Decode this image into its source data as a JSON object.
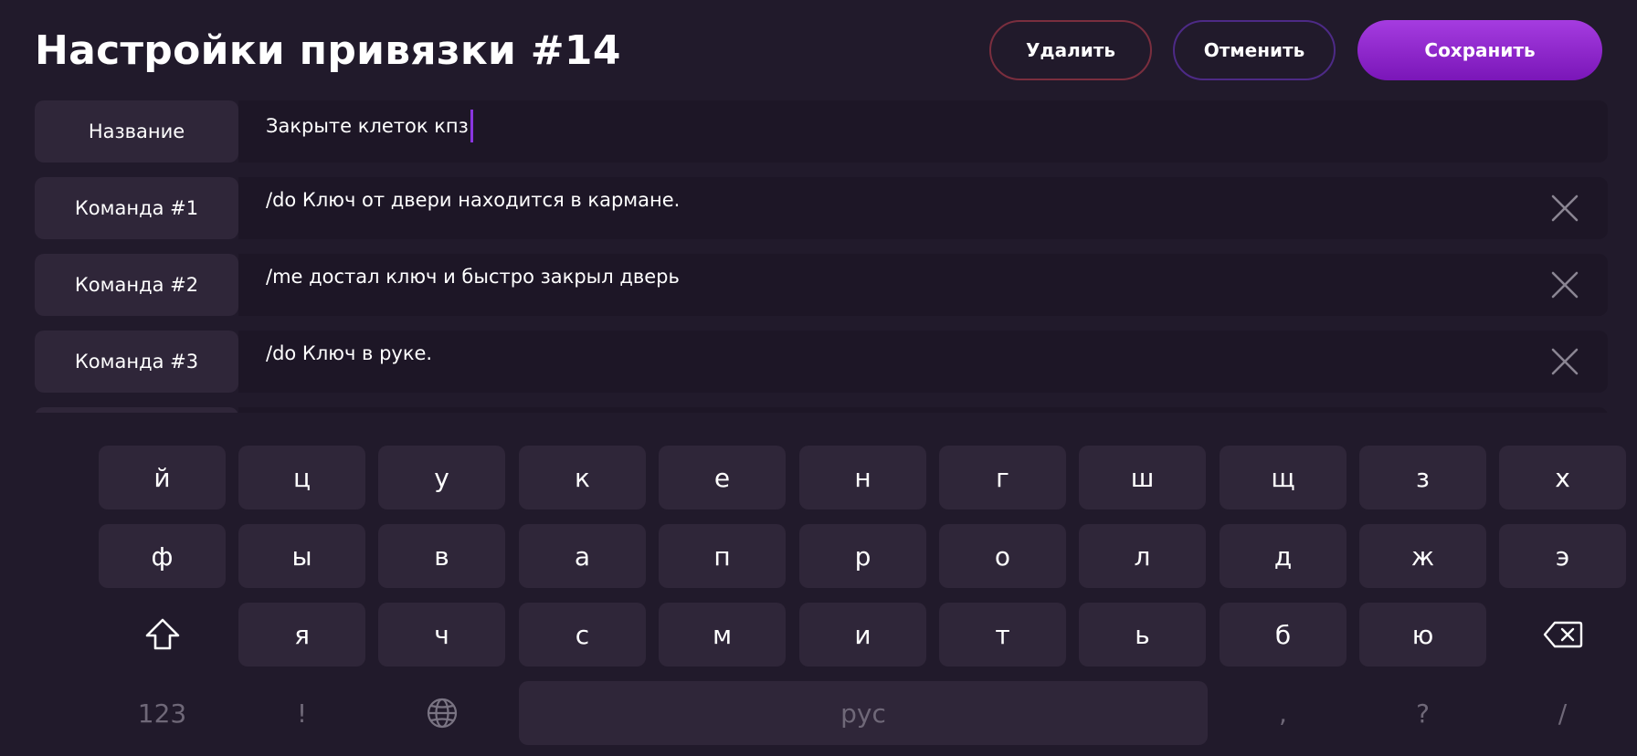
{
  "header": {
    "title": "Настройки привязки #14",
    "delete_label": "Удалить",
    "cancel_label": "Отменить",
    "save_label": "Сохранить"
  },
  "rows": [
    {
      "label": "Название",
      "value": "Закрыте клеток кпз",
      "focused": true,
      "clearable": false
    },
    {
      "label": "Команда #1",
      "value": "/do Ключ от двери находится в кармане.",
      "clearable": true
    },
    {
      "label": "Команда #2",
      "value": "/me достал ключ и быстро закрыл дверь",
      "clearable": true
    },
    {
      "label": "Команда #3",
      "value": "/do Ключ в руке.",
      "clearable": true
    }
  ],
  "keyboard": {
    "row1": [
      "й",
      "ц",
      "у",
      "к",
      "е",
      "н",
      "г",
      "ш",
      "щ",
      "з",
      "х"
    ],
    "row2": [
      "ф",
      "ы",
      "в",
      "а",
      "п",
      "р",
      "о",
      "л",
      "д",
      "ж",
      "э"
    ],
    "row3": [
      "я",
      "ч",
      "с",
      "м",
      "и",
      "т",
      "ь",
      "б",
      "ю"
    ],
    "shift_icon": "shift-arrow-icon",
    "backspace_icon": "backspace-icon",
    "numbers_label": "123",
    "exclamation_label": "!",
    "globe_icon": "globe-icon",
    "space_label": "рус",
    "comma_label": ",",
    "question_label": "?",
    "slash_label": "/"
  },
  "colors": {
    "background": "#211a2b",
    "key": "#2f2639",
    "field": "#1d1626",
    "save_accent": "#9a2fd6",
    "delete_border": "#7a2e3e",
    "cancel_border": "#4d2a86",
    "cursor": "#8a35e0"
  }
}
